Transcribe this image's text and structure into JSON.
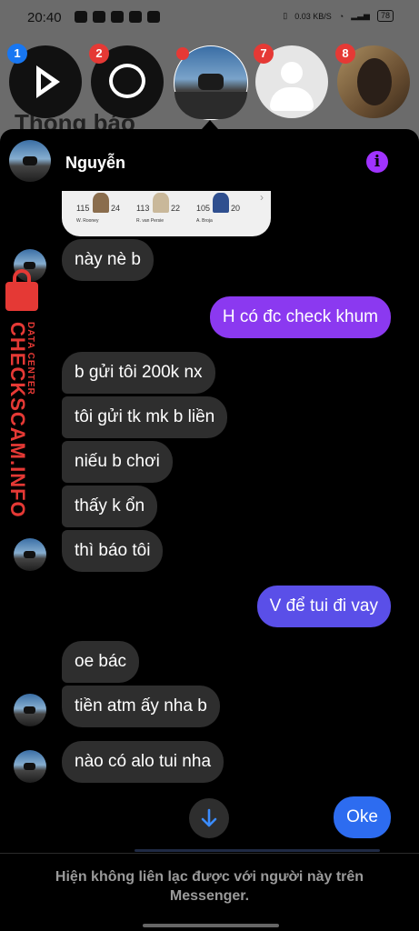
{
  "status_bar": {
    "time": "20:40",
    "net_speed": "0.03 KB/S",
    "battery": "78"
  },
  "background": {
    "title": "Thông báo"
  },
  "chat_heads": {
    "badges": [
      "1",
      "2",
      "7",
      "8"
    ],
    "items": [
      {
        "name": "video-player-head",
        "badge": "1",
        "badge_color": "#1877f2"
      },
      {
        "name": "messenger-head",
        "badge": "2",
        "badge_color": "#e53935"
      },
      {
        "name": "active-chat-head"
      },
      {
        "name": "contact-head-7",
        "badge": "7",
        "badge_color": "#e53935"
      },
      {
        "name": "contact-head-8",
        "badge": "8",
        "badge_color": "#e53935"
      }
    ]
  },
  "chat": {
    "contact_name": "Nguyễn",
    "info_icon": "i",
    "shared_card": {
      "players": [
        {
          "rating": "115",
          "label": "W. Rooney"
        },
        {
          "rating": "113",
          "label": "R. van Persie"
        },
        {
          "rating": "105",
          "label": "A. Broja"
        }
      ],
      "extra_numbers": [
        "24",
        "22",
        "20"
      ]
    },
    "messages": [
      {
        "side": "in",
        "text": "này nè b"
      },
      {
        "side": "out",
        "text": "H có đc check khum",
        "color": "#8b39f0"
      },
      {
        "side": "in",
        "text": "b gửi tôi 200k nx"
      },
      {
        "side": "in",
        "text": "tôi gửi tk mk b liền"
      },
      {
        "side": "in",
        "text": "niếu b chơi"
      },
      {
        "side": "in",
        "text": "thấy k ổn"
      },
      {
        "side": "in",
        "text": "thì báo tôi"
      },
      {
        "side": "out",
        "text": "V để tui đi vay",
        "color": "#5a4fe8"
      },
      {
        "side": "in",
        "text": "oe bác"
      },
      {
        "side": "in",
        "text": "tiền atm ấy nha b"
      },
      {
        "side": "in",
        "text": "nào có alo tui nha"
      },
      {
        "side": "out",
        "text": "Oke",
        "color": "#2d6cf0"
      }
    ],
    "footer_notice": "Hiện không liên lạc được với người này trên Messenger."
  },
  "watermark": {
    "line1": "CHECKSCAM.INFO",
    "line2": "DATA CENTER"
  },
  "colors": {
    "accent_purple": "#a033ff",
    "badge_red": "#e53935",
    "badge_blue": "#1877f2"
  }
}
